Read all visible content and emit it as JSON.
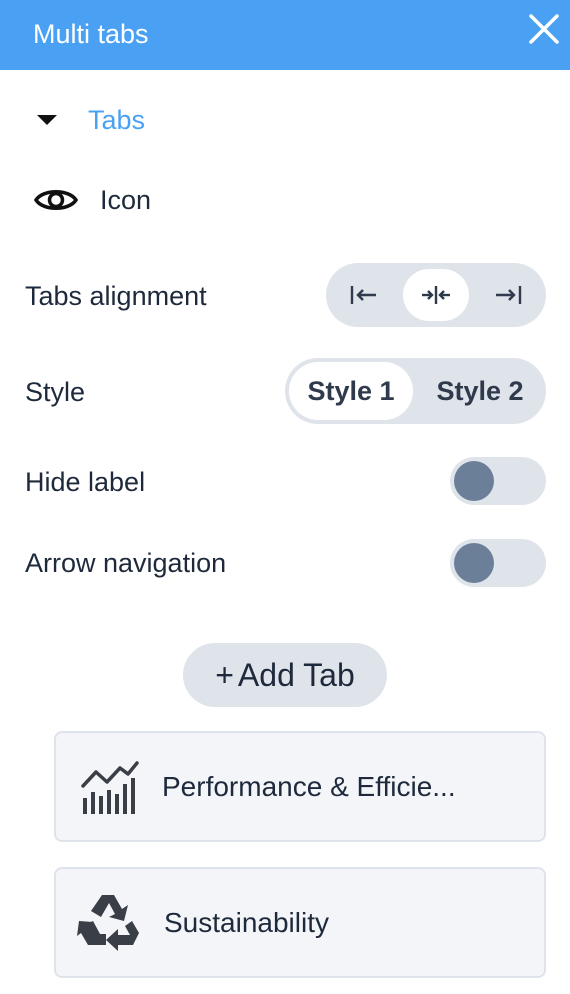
{
  "header": {
    "title": "Multi tabs",
    "close_icon": "close-icon"
  },
  "tabs_section": {
    "label": "Tabs",
    "caret_icon": "caret-down-icon",
    "link_color": "#4aa1f3"
  },
  "icon_row": {
    "label": "Icon",
    "icon": "eye-icon"
  },
  "tabs_alignment": {
    "label": "Tabs alignment",
    "options": [
      "align-left-icon",
      "align-center-icon",
      "align-right-icon"
    ],
    "selected": "align-center-icon"
  },
  "style": {
    "label": "Style",
    "options": [
      "Style 1",
      "Style 2"
    ],
    "selected": "Style 1"
  },
  "hide_label": {
    "label": "Hide label",
    "enabled": false
  },
  "arrow_navigation": {
    "label": "Arrow navigation",
    "enabled": false
  },
  "add_tab": {
    "plus": "+",
    "label": "Add Tab"
  },
  "tab_items": [
    {
      "label": "Performance & Efficie...",
      "icon": "chart-bars-icon"
    },
    {
      "label": "Sustainability",
      "icon": "recycle-icon"
    }
  ],
  "colors": {
    "accent": "#4aa1f3",
    "toggle_track": "#dfe3ea",
    "toggle_knob": "#6b7f99",
    "card_bg": "#f4f5f9"
  }
}
